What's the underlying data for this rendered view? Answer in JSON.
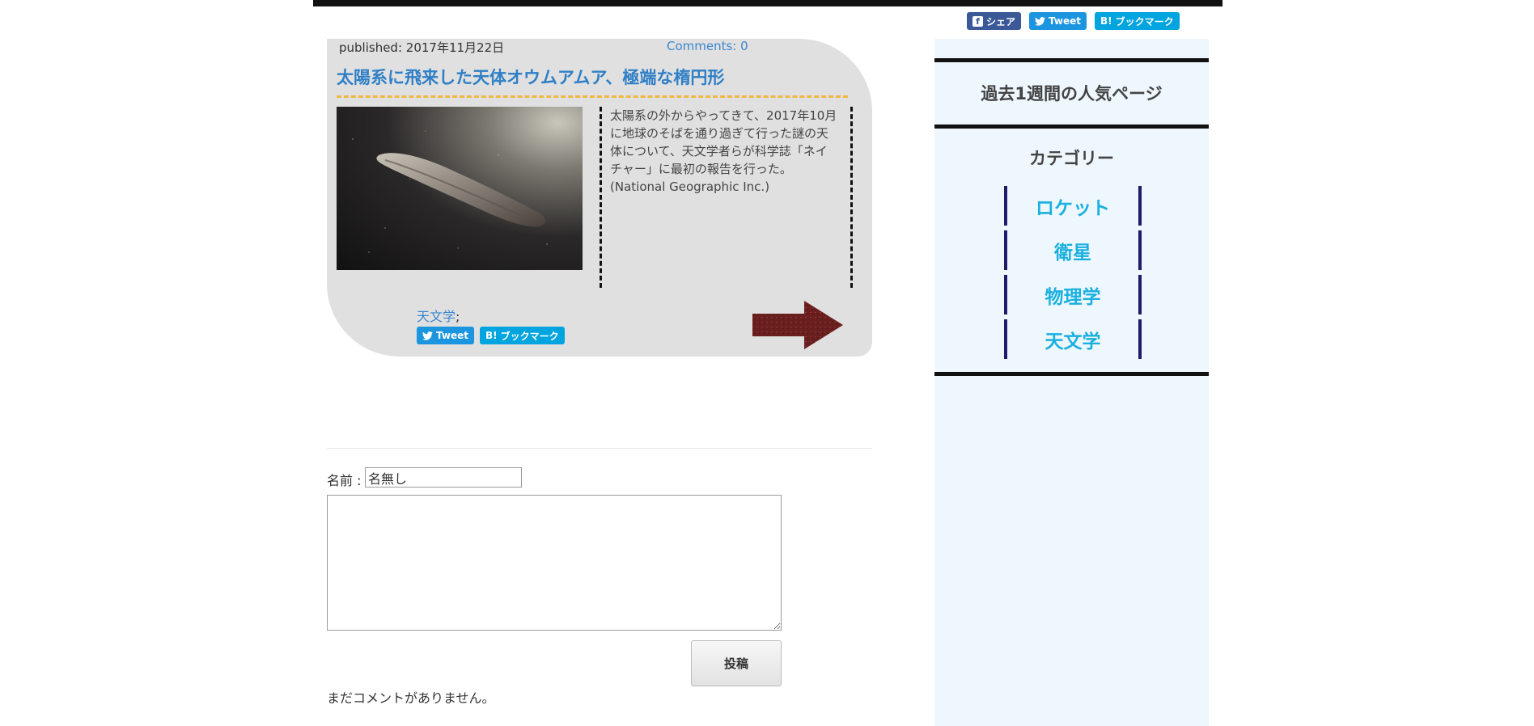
{
  "header": {
    "share": {
      "facebook_label": "シェア",
      "tweet_label": "Tweet",
      "hatena_label": "ブックマーク",
      "hatena_mark": "B!"
    }
  },
  "post": {
    "published": "published: 2017年11月22日",
    "comments_link": "Comments: 0",
    "title": "太陽系に飛来した天体オウムアムア、極端な楕円形",
    "excerpt_line1": "太陽系の外からやってきて、2017年10月",
    "excerpt_line2": "に地球のそばを通り過ぎて行った謎の天",
    "excerpt_line3": "体について、天文学者らが科学誌「ネイ",
    "excerpt_line4": "チャー」に最初の報告を行った。",
    "excerpt_line5": "(National Geographic Inc.)",
    "tag": "天文学",
    "tag_separator": ";",
    "tweet_label": "Tweet",
    "hatena_label": "ブックマーク",
    "hatena_mark": "B!"
  },
  "comment_form": {
    "name_label": "名前 :",
    "name_value": "名無し",
    "submit_label": "投稿",
    "empty_message": "まだコメントがありません。"
  },
  "sidebar": {
    "popular_heading": "過去1週間の人気ページ",
    "category_heading": "カテゴリー",
    "categories": [
      "ロケット",
      "衛星",
      "物理学",
      "天文学"
    ]
  },
  "colors": {
    "link_blue": "#3a87d0",
    "category_cyan": "#1ab0e0",
    "sidebar_bg": "#eef7fd",
    "card_bg": "#e0e0e0",
    "title_rule": "#f0b840"
  }
}
